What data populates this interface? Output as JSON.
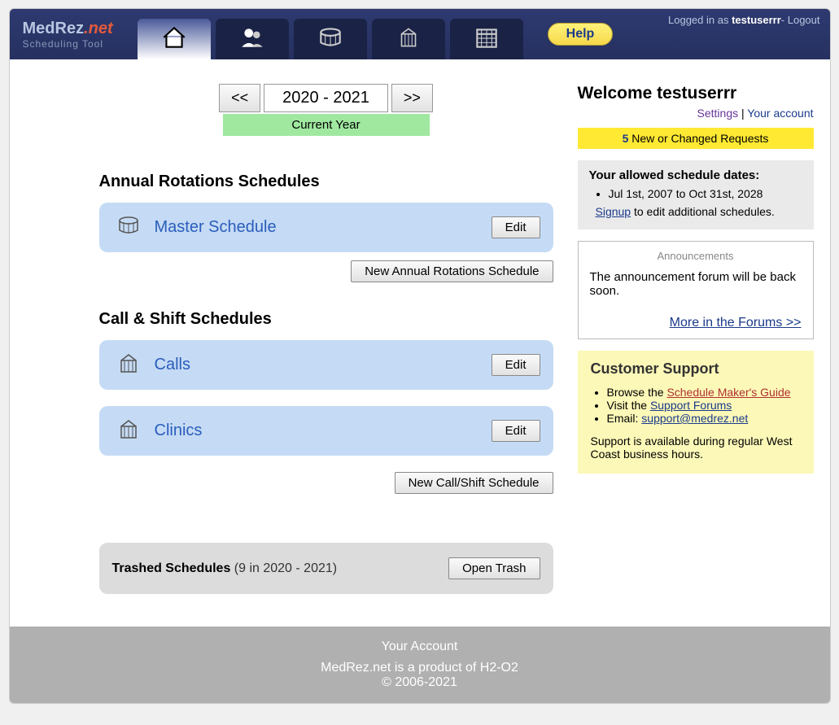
{
  "header": {
    "logo_brand": "MedRez",
    "logo_suffix": ".net",
    "logo_sub": "Scheduling Tool",
    "help": "Help",
    "login_prefix": "Logged in as ",
    "login_user": "testuserrr",
    "login_sep": "- ",
    "logout": "Logout"
  },
  "year": {
    "prev": "<<",
    "range": "2020 - 2021",
    "next": ">>",
    "current": "Current Year"
  },
  "sections": {
    "annual_title": "Annual Rotations Schedules",
    "annual_items": [
      {
        "name": "Master Schedule",
        "edit": "Edit"
      }
    ],
    "annual_new": "New Annual Rotations Schedule",
    "calls_title": "Call & Shift Schedules",
    "calls_items": [
      {
        "name": "Calls",
        "edit": "Edit"
      },
      {
        "name": "Clinics",
        "edit": "Edit"
      }
    ],
    "calls_new": "New Call/Shift Schedule"
  },
  "trash": {
    "label_bold": "Trashed Schedules",
    "label_rest": " (9 in 2020 - 2021)",
    "button": "Open Trash"
  },
  "side": {
    "welcome": "Welcome testuserrr",
    "settings": "Settings",
    "sep": " | ",
    "account": "Your account",
    "req_count": "5",
    "req_text": " New or Changed Requests",
    "dates_hd": "Your allowed schedule dates:",
    "dates_range": "Jul 1st, 2007 to Oct 31st, 2028",
    "signup": "Signup",
    "signup_rest": " to edit additional schedules.",
    "ann_hd": "Announcements",
    "ann_body": "The announcement forum will be back soon.",
    "ann_more": "More in the Forums >>",
    "supp_hd": "Customer Support",
    "supp_browse": "Browse the ",
    "supp_guide": "Schedule Maker's Guide",
    "supp_visit": "Visit the ",
    "supp_forums": "Support Forums",
    "supp_email_label": "Email: ",
    "supp_email": "support@medrez.net",
    "supp_hours": "Support is available during regular West Coast business hours."
  },
  "footer": {
    "account": "Your Account",
    "product": "MedRez.net is a product of H2-O2",
    "copyright": "© 2006-2021"
  }
}
